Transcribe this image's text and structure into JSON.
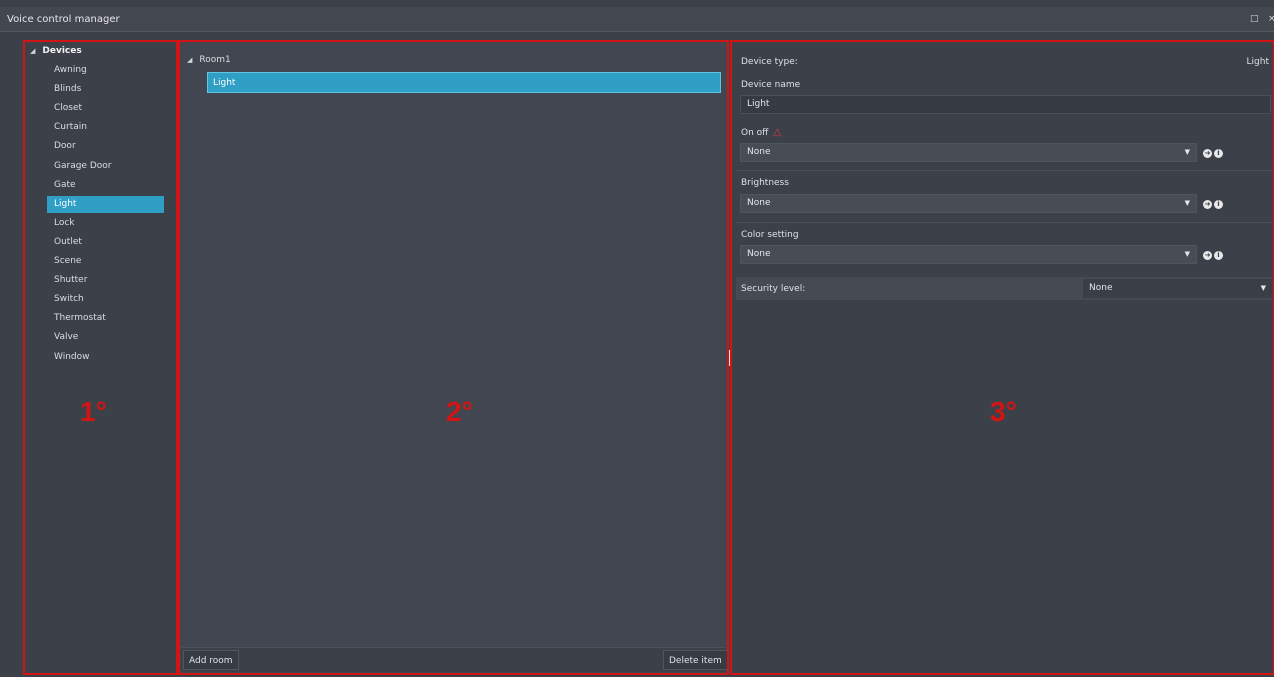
{
  "window": {
    "title": "Voice control manager",
    "maximize_icon": "□",
    "close_icon": "×"
  },
  "panel_markers": [
    "1°",
    "2°",
    "3°"
  ],
  "device_tree": {
    "root_label": "Devices",
    "items": [
      "Awning",
      "Blinds",
      "Closet",
      "Curtain",
      "Door",
      "Garage Door",
      "Gate",
      "Light",
      "Lock",
      "Outlet",
      "Scene",
      "Shutter",
      "Switch",
      "Thermostat",
      "Valve",
      "Window"
    ],
    "selected": "Light"
  },
  "rooms": {
    "room_label": "Room1",
    "items": [
      {
        "label": "Light"
      }
    ],
    "add_room_label": "Add room",
    "delete_item_label": "Delete item"
  },
  "properties": {
    "device_type_label": "Device type:",
    "device_type_value": "Light",
    "device_name_label": "Device name",
    "device_name_value": "Light",
    "on_off_label": "On off",
    "on_off_value": "None",
    "brightness_label": "Brightness",
    "brightness_value": "None",
    "color_label": "Color setting",
    "color_value": "None",
    "security_label": "Security level:",
    "security_value": "None"
  },
  "colors": {
    "accent": "#2f9fc5",
    "annotation": "#d21414",
    "panel_bg": "#3c4049"
  }
}
